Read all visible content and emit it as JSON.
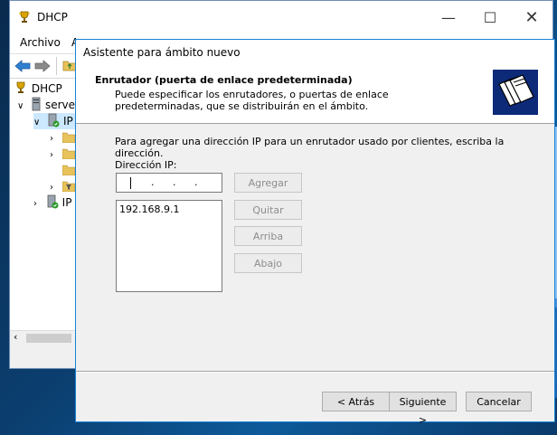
{
  "mmc": {
    "title": "DHCP",
    "menu": [
      "Archivo",
      "A"
    ],
    "tree": {
      "root": "DHCP",
      "server": "serve",
      "ipv4": "IP",
      "ipv6": "IP"
    }
  },
  "wizard": {
    "title": "Asistente para ámbito nuevo",
    "heading": "Enrutador (puerta de enlace predeterminada)",
    "subheading": "Puede especificar los enrutadores, o puertas de enlace predeterminadas, que se distribuirán en el ámbito.",
    "instruction": "Para agregar una dirección IP para un enrutador usado por clientes, escriba la dirección.",
    "ip_label": "Dirección IP:",
    "ip_value_dots": [
      ".",
      ".",
      "."
    ],
    "routers": [
      "192.168.9.1"
    ],
    "buttons": {
      "add": "Agregar",
      "remove": "Quitar",
      "up": "Arriba",
      "down": "Abajo"
    },
    "nav": {
      "back": "< Atrás",
      "next": "Siguiente >",
      "cancel": "Cancelar"
    }
  },
  "colors": {
    "accent_border": "#1883d7",
    "logo_bg": "#0d2a78"
  }
}
